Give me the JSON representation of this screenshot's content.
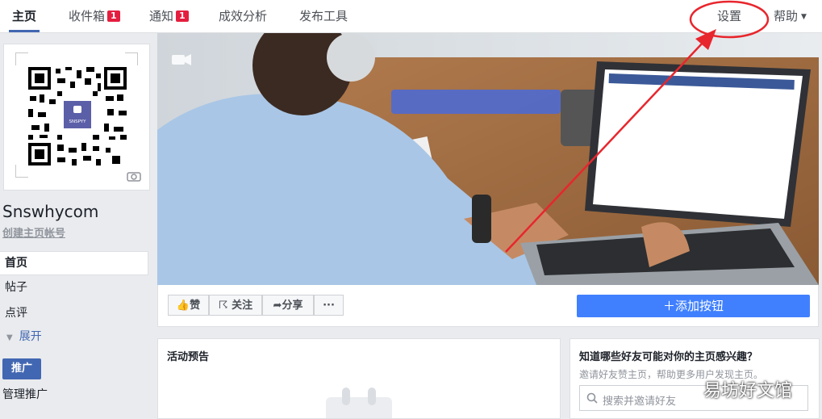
{
  "nav": {
    "tabs": [
      {
        "label": "主页"
      },
      {
        "label": "收件箱",
        "badge": "1"
      },
      {
        "label": "通知",
        "badge": "1"
      },
      {
        "label": "成效分析"
      },
      {
        "label": "发布工具"
      }
    ],
    "settings_label": "设置",
    "help_label": "帮助"
  },
  "page": {
    "name": "Snswhycom",
    "create_username": "创建主页帐号",
    "logo_text": "SNSPYY"
  },
  "sidebar": {
    "items": [
      {
        "label": "首页"
      },
      {
        "label": "帖子"
      },
      {
        "label": "点评"
      },
      {
        "label": "展开"
      }
    ],
    "promote_label": "推广",
    "manage_promotions": "管理推广"
  },
  "actions": {
    "like": "赞",
    "follow": "关注",
    "share": "分享",
    "more": "···",
    "add_button": "添加按钮"
  },
  "events": {
    "title": "活动预告"
  },
  "invite": {
    "title": "知道哪些好友可能对你的主页感兴趣？",
    "subtitle": "邀请好友赞主页，帮助更多用户发现主页。",
    "search_placeholder": "搜索并邀请好友"
  },
  "watermark": "易坊好文馆",
  "colors": {
    "brand": "#4267b2",
    "cta": "#4080ff",
    "badge": "#e41e3f",
    "annotation": "#e8262d"
  }
}
